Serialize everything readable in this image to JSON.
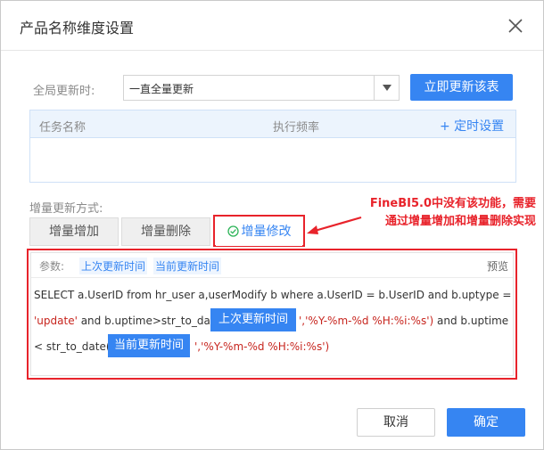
{
  "dialog": {
    "title": "产品名称维度设置",
    "global_update_label": "全局更新时:",
    "global_update_value": "一直全量更新",
    "update_now_button": "立即更新该表",
    "task_table": {
      "headers": [
        "任务名称",
        "执行频率"
      ],
      "timer_setting": "+  定时设置"
    },
    "incremental_label": "增量更新方式:",
    "tabs": [
      "增量增加",
      "增量删除",
      "增量修改"
    ],
    "annotation": {
      "line1": "FineBI5.0中没有该功能，需要",
      "line2": "通过增量增加和增量删除实现"
    },
    "params": {
      "label": "参数:",
      "tags": [
        "上次更新时间",
        "当前更新时间"
      ],
      "preview": "预览"
    },
    "sql": {
      "line1": "SELECT a.UserID from hr_user a,userModify b where a.UserID = b.UserID and b.uptype =",
      "line2_red1": "'update'",
      "line2_mid": " and b.uptime>str_to_date('",
      "chip1": "上次更新时间",
      "line2_red2": "','%Y-%m-%d %H:%i:%s')",
      "line2_end": "  and b.uptime",
      "line3_start": "< str_to_date('",
      "chip2": "当前更新时间",
      "line3_end": "','%Y-%m-%d %H:%i:%s')"
    },
    "cancel_button": "取消",
    "ok_button": "确定"
  },
  "colors": {
    "primary": "#3685f2",
    "annotation_red": "#e8232b"
  }
}
